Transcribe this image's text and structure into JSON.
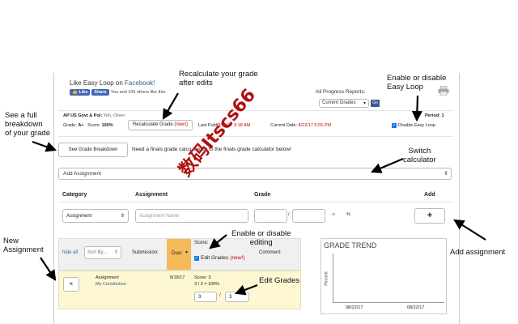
{
  "annotations": {
    "recalc": "Recalculate your grade\nafter edits",
    "easyloop": "Enable or disable\nEasy Loop",
    "breakdown": "See a full\nbreakdown\nof your grade",
    "switch": "Switch\ncalculator",
    "new_assignment": "New\nAssignment",
    "enable_editing": "Enable or disable\nediting",
    "edit_grades": "Edit Grades",
    "add_assignment": "Add assignment"
  },
  "facebook": {
    "title_prefix": "Like Easy Loop on ",
    "title_link": "Facebook!",
    "like_label": "Like",
    "share_label": "Share",
    "social_text": "You and 105 others like this."
  },
  "progress": {
    "label": "All Progress Reports:",
    "selected": "Current Grades",
    "go_label": "Go"
  },
  "course": {
    "name": "AP US Govt & Pol:",
    "teacher": "Yeh, Oliver",
    "period": "Period: 1",
    "grade_label": "Grade:",
    "grade_value": "A+",
    "score_label": "Score:",
    "score_value": "100%",
    "recalc_label": "Recalculate Grade",
    "recalc_new": "(new!)",
    "last_published_label": "Last Publi",
    "last_published_value": "8/22/17 9:18 AM",
    "current_date_label": "Current Date:",
    "current_date_value": "8/22/17 5:55 PM",
    "disable_easy_loop": "Disable Easy Loop"
  },
  "breakdown": {
    "button_label": "See Grade Breakdown",
    "message": "Need a finals grade calcu",
    "message_tail": "switch to the finals grade calculator below!"
  },
  "add_assignment_select": "Add Assignment",
  "form": {
    "headers": {
      "category": "Category",
      "assignment": "Assignment",
      "grade": "Grade",
      "add": "Add"
    },
    "category_value": "Assignment",
    "assignment_placeholder": "Assignment Name",
    "slash": "/",
    "arrow": "->",
    "percent": "%",
    "add_button": "+"
  },
  "table": {
    "hide_all": "hide all",
    "sort_by": "Sort By...",
    "submission": "Submission:",
    "due": "Due:",
    "score_label": "Score:",
    "edit_grades": "Edit Grades",
    "edit_grades_new": "(new!)",
    "comment": "Comment:",
    "row": {
      "delete": "×",
      "type": "Assignment",
      "name": "My Constitution",
      "date": "8/18/17",
      "score_text": "Score: 3",
      "score_calc": "3 / 3 = 100%",
      "earned": "3",
      "slash": "/",
      "possible": "3"
    }
  },
  "trend": {
    "title": "GRADE TREND",
    "ylabel": "Percent",
    "x_ticks": [
      "08/22/17",
      "08/22/17"
    ]
  },
  "watermark": "数码Itscs66"
}
